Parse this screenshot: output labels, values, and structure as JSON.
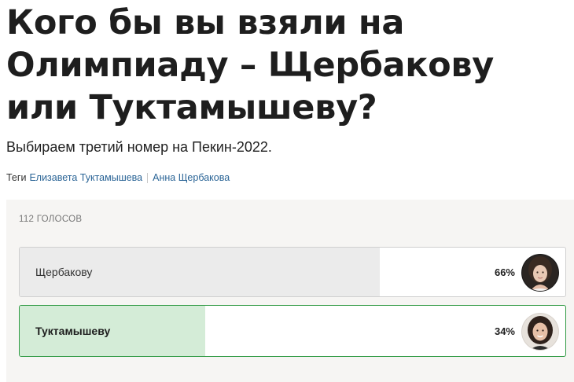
{
  "article": {
    "title": "Кого бы вы взяли на Олимпиаду – Щербакову или Туктамышеву?",
    "subtitle": "Выбираем третий номер на Пекин-2022.",
    "tags_label": "Теги",
    "tags": [
      "Елизавета Туктамышева",
      "Анна Щербакова"
    ]
  },
  "poll": {
    "votes_text": "112 ГОЛОСОВ",
    "options": [
      {
        "label": "Щербакову",
        "percent_text": "66%",
        "percent": 66,
        "selected": false,
        "avatar": "portrait-shcherbakova"
      },
      {
        "label": "Туктамышеву",
        "percent_text": "34%",
        "percent": 34,
        "selected": true,
        "avatar": "portrait-tuktamysheva"
      }
    ]
  },
  "colors": {
    "text": "#1e1e1e",
    "link": "#2a6496",
    "poll_bg": "#f6f5f3",
    "bar_neutral": "#ebebeb",
    "bar_selected": "#d4ecd7",
    "selected_border": "#2f9a43"
  }
}
